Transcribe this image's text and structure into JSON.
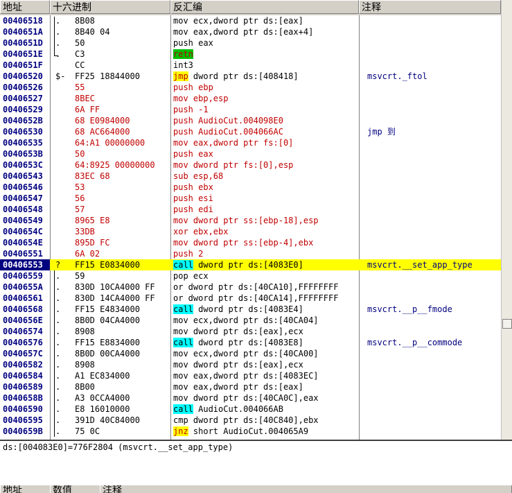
{
  "headers": {
    "address": "地址",
    "hex": "十六进制",
    "disasm": "反汇编",
    "comment": "注释"
  },
  "rows": [
    {
      "addr": "00406518",
      "mark": ".",
      "hex": "8B08",
      "op": "mov",
      "rest": " ecx,dword ptr ds:[eax]",
      "comment": ""
    },
    {
      "addr": "0040651A",
      "mark": ".",
      "hex": "8B40 04",
      "op": "mov",
      "rest": " eax,dword ptr ds:[eax+4]",
      "comment": ""
    },
    {
      "addr": "0040651D",
      "mark": ".",
      "hex": "50",
      "op": "push",
      "rest": " eax",
      "comment": ""
    },
    {
      "addr": "0040651E",
      "mark": ".",
      "hex": "C3",
      "op": "retn",
      "rest": "",
      "comment": ""
    },
    {
      "addr": "0040651F",
      "mark": "",
      "hex": "CC",
      "op": "int3",
      "rest": "",
      "comment": ""
    },
    {
      "addr": "00406520",
      "mark": "$-",
      "hex": "FF25 18844000",
      "op": "jmp",
      "rest": " dword ptr ds:[408418]",
      "comment": "msvcrt._ftol"
    },
    {
      "addr": "00406526",
      "mark": "",
      "hex": "55",
      "op": "push",
      "rest": " ebp",
      "comment": ""
    },
    {
      "addr": "00406527",
      "mark": "",
      "hex": "8BEC",
      "op": "mov",
      "rest": " ebp,esp",
      "comment": ""
    },
    {
      "addr": "00406529",
      "mark": "",
      "hex": "6A FF",
      "op": "push",
      "rest": " -1",
      "comment": ""
    },
    {
      "addr": "0040652B",
      "mark": "",
      "hex": "68 E0984000",
      "op": "push",
      "rest": " AudioCut.004098E0",
      "comment": ""
    },
    {
      "addr": "00406530",
      "mark": "",
      "hex": "68 AC664000",
      "op": "push",
      "rest": " AudioCut.004066AC",
      "comment": "jmp 到"
    },
    {
      "addr": "00406535",
      "mark": "",
      "hex": "64:A1 00000000",
      "op": "mov",
      "rest": " eax,dword ptr fs:[0]",
      "comment": ""
    },
    {
      "addr": "0040653B",
      "mark": "",
      "hex": "50",
      "op": "push",
      "rest": " eax",
      "comment": ""
    },
    {
      "addr": "0040653C",
      "mark": "",
      "hex": "64:8925 00000000",
      "op": "mov",
      "rest": " dword ptr fs:[0],esp",
      "comment": ""
    },
    {
      "addr": "00406543",
      "mark": "",
      "hex": "83EC 68",
      "op": "sub",
      "rest": " esp,68",
      "comment": ""
    },
    {
      "addr": "00406546",
      "mark": "",
      "hex": "53",
      "op": "push",
      "rest": " ebx",
      "comment": ""
    },
    {
      "addr": "00406547",
      "mark": "",
      "hex": "56",
      "op": "push",
      "rest": " esi",
      "comment": ""
    },
    {
      "addr": "00406548",
      "mark": "",
      "hex": "57",
      "op": "push",
      "rest": " edi",
      "comment": ""
    },
    {
      "addr": "00406549",
      "mark": "",
      "hex": "8965 E8",
      "op": "mov",
      "rest": " dword ptr ss:[ebp-18],esp",
      "comment": ""
    },
    {
      "addr": "0040654C",
      "mark": "",
      "hex": "33DB",
      "op": "xor",
      "rest": " ebx,ebx",
      "comment": ""
    },
    {
      "addr": "0040654E",
      "mark": "",
      "hex": "895D FC",
      "op": "mov",
      "rest": " dword ptr ss:[ebp-4],ebx",
      "comment": ""
    },
    {
      "addr": "00406551",
      "mark": "",
      "hex": "6A 02",
      "op": "push",
      "rest": " 2",
      "comment": ""
    },
    {
      "addr": "00406553",
      "mark": "?",
      "hex": "FF15 E0834000",
      "op": "call",
      "rest": " dword ptr ds:[4083E0]",
      "comment": "msvcrt.__set_app_type"
    },
    {
      "addr": "00406559",
      "mark": ".",
      "hex": "59",
      "op": "pop",
      "rest": " ecx",
      "comment": ""
    },
    {
      "addr": "0040655A",
      "mark": ".",
      "hex": "830D 10CA4000 FF",
      "op": "or",
      "rest": " dword ptr ds:[40CA10],FFFFFFFF",
      "comment": ""
    },
    {
      "addr": "00406561",
      "mark": ".",
      "hex": "830D 14CA4000 FF",
      "op": "or",
      "rest": " dword ptr ds:[40CA14],FFFFFFFF",
      "comment": ""
    },
    {
      "addr": "00406568",
      "mark": ".",
      "hex": "FF15 E4834000",
      "op": "call",
      "rest": " dword ptr ds:[4083E4]",
      "comment": "msvcrt.__p__fmode"
    },
    {
      "addr": "0040656E",
      "mark": ".",
      "hex": "8B0D 04CA4000",
      "op": "mov",
      "rest": " ecx,dword ptr ds:[40CA04]",
      "comment": ""
    },
    {
      "addr": "00406574",
      "mark": ".",
      "hex": "8908",
      "op": "mov",
      "rest": " dword ptr ds:[eax],ecx",
      "comment": ""
    },
    {
      "addr": "00406576",
      "mark": ".",
      "hex": "FF15 E8834000",
      "op": "call",
      "rest": " dword ptr ds:[4083E8]",
      "comment": "msvcrt.__p__commode"
    },
    {
      "addr": "0040657C",
      "mark": ".",
      "hex": "8B0D 00CA4000",
      "op": "mov",
      "rest": " ecx,dword ptr ds:[40CA00]",
      "comment": ""
    },
    {
      "addr": "00406582",
      "mark": ".",
      "hex": "8908",
      "op": "mov",
      "rest": " dword ptr ds:[eax],ecx",
      "comment": ""
    },
    {
      "addr": "00406584",
      "mark": ".",
      "hex": "A1 EC834000",
      "op": "mov",
      "rest": " eax,dword ptr ds:[4083EC]",
      "comment": ""
    },
    {
      "addr": "00406589",
      "mark": ".",
      "hex": "8B00",
      "op": "mov",
      "rest": " eax,dword ptr ds:[eax]",
      "comment": ""
    },
    {
      "addr": "0040658B",
      "mark": ".",
      "hex": "A3 0CCA4000",
      "op": "mov",
      "rest": " dword ptr ds:[40CA0C],eax",
      "comment": ""
    },
    {
      "addr": "00406590",
      "mark": ".",
      "hex": "E8 16010000",
      "op": "call",
      "rest": " AudioCut.004066AB",
      "comment": ""
    },
    {
      "addr": "00406595",
      "mark": ".",
      "hex": "391D 40C84000",
      "op": "cmp",
      "rest": " dword ptr ds:[40C840],ebx",
      "comment": ""
    },
    {
      "addr": "0040659B",
      "mark": ".",
      "hex": "75 0C",
      "op": "jnz",
      "rest": " short AudioCut.004065A9",
      "comment": ""
    }
  ],
  "info_line": "ds:[004083E0]=776F2804 (msvcrt.__set_app_type)",
  "bottom_headers": {
    "address": "地址",
    "value": "数值",
    "comment": "注释"
  }
}
